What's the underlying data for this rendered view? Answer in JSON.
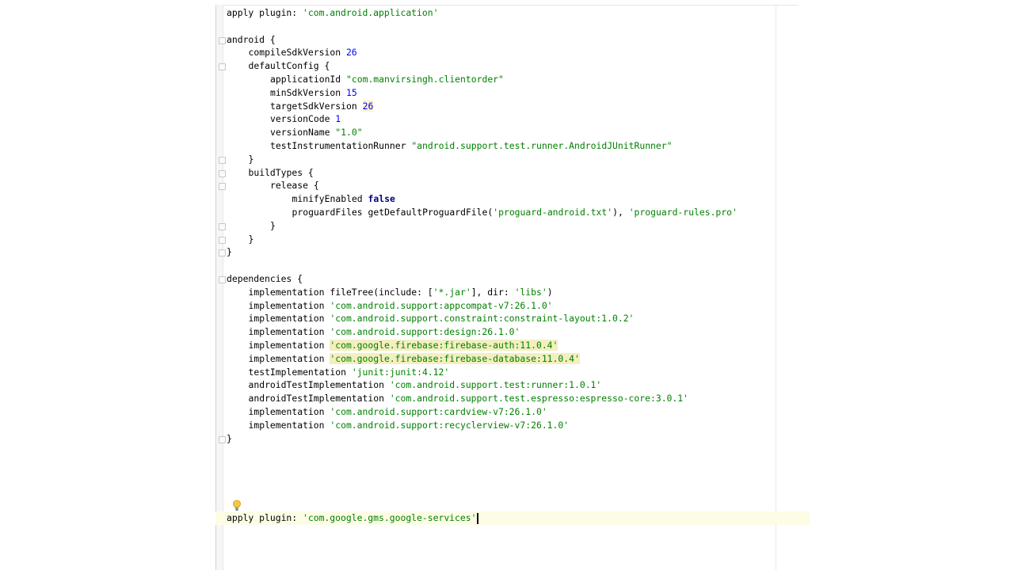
{
  "editor": {
    "lines": [
      {
        "indent": 0,
        "tokens": [
          {
            "t": "apply plugin: ",
            "c": ""
          },
          {
            "t": "'com.android.application'",
            "c": "str"
          }
        ]
      },
      {
        "indent": 0,
        "tokens": []
      },
      {
        "indent": 0,
        "tokens": [
          {
            "t": "android {",
            "c": ""
          }
        ]
      },
      {
        "indent": 1,
        "tokens": [
          {
            "t": "compileSdkVersion ",
            "c": ""
          },
          {
            "t": "26",
            "c": "num"
          }
        ]
      },
      {
        "indent": 1,
        "tokens": [
          {
            "t": "defaultConfig {",
            "c": ""
          }
        ]
      },
      {
        "indent": 2,
        "tokens": [
          {
            "t": "applicationId ",
            "c": ""
          },
          {
            "t": "\"com.manvirsingh.clientorder\"",
            "c": "str"
          }
        ]
      },
      {
        "indent": 2,
        "tokens": [
          {
            "t": "minSdkVersion ",
            "c": ""
          },
          {
            "t": "15",
            "c": "num"
          }
        ]
      },
      {
        "indent": 2,
        "tokens": [
          {
            "t": "targetSdkVersion ",
            "c": ""
          },
          {
            "t": "26",
            "c": "num warn"
          }
        ]
      },
      {
        "indent": 2,
        "tokens": [
          {
            "t": "versionCode ",
            "c": ""
          },
          {
            "t": "1",
            "c": "num"
          }
        ]
      },
      {
        "indent": 2,
        "tokens": [
          {
            "t": "versionName ",
            "c": ""
          },
          {
            "t": "\"1.0\"",
            "c": "str"
          }
        ]
      },
      {
        "indent": 2,
        "tokens": [
          {
            "t": "testInstrumentationRunner ",
            "c": ""
          },
          {
            "t": "\"android.support.test.runner.AndroidJUnitRunner\"",
            "c": "str"
          }
        ]
      },
      {
        "indent": 1,
        "tokens": [
          {
            "t": "}",
            "c": ""
          }
        ]
      },
      {
        "indent": 1,
        "tokens": [
          {
            "t": "buildTypes {",
            "c": ""
          }
        ]
      },
      {
        "indent": 2,
        "tokens": [
          {
            "t": "release {",
            "c": ""
          }
        ]
      },
      {
        "indent": 3,
        "tokens": [
          {
            "t": "minifyEnabled ",
            "c": ""
          },
          {
            "t": "false",
            "c": "kw"
          }
        ]
      },
      {
        "indent": 3,
        "tokens": [
          {
            "t": "proguardFiles getDefaultProguardFile(",
            "c": ""
          },
          {
            "t": "'proguard-android.txt'",
            "c": "str"
          },
          {
            "t": "), ",
            "c": ""
          },
          {
            "t": "'proguard-rules.pro'",
            "c": "str"
          }
        ]
      },
      {
        "indent": 2,
        "tokens": [
          {
            "t": "}",
            "c": ""
          }
        ]
      },
      {
        "indent": 1,
        "tokens": [
          {
            "t": "}",
            "c": ""
          }
        ]
      },
      {
        "indent": 0,
        "tokens": [
          {
            "t": "}",
            "c": ""
          }
        ]
      },
      {
        "indent": 0,
        "tokens": []
      },
      {
        "indent": 0,
        "tokens": [
          {
            "t": "dependencies {",
            "c": ""
          }
        ]
      },
      {
        "indent": 1,
        "tokens": [
          {
            "t": "implementation fileTree(include: [",
            "c": ""
          },
          {
            "t": "'*.jar'",
            "c": "str"
          },
          {
            "t": "], dir: ",
            "c": ""
          },
          {
            "t": "'libs'",
            "c": "str"
          },
          {
            "t": ")",
            "c": ""
          }
        ]
      },
      {
        "indent": 1,
        "tokens": [
          {
            "t": "implementation ",
            "c": ""
          },
          {
            "t": "'com.android.support:appcompat-v7:26.1.0'",
            "c": "str"
          }
        ]
      },
      {
        "indent": 1,
        "tokens": [
          {
            "t": "implementation ",
            "c": ""
          },
          {
            "t": "'com.android.support.constraint:constraint-layout:1.0.2'",
            "c": "str"
          }
        ]
      },
      {
        "indent": 1,
        "tokens": [
          {
            "t": "implementation ",
            "c": ""
          },
          {
            "t": "'com.android.support:design:26.1.0'",
            "c": "str"
          }
        ]
      },
      {
        "indent": 1,
        "tokens": [
          {
            "t": "implementation ",
            "c": ""
          },
          {
            "t": "'com.google.firebase:firebase-auth:11.0.4'",
            "c": "str hl"
          }
        ]
      },
      {
        "indent": 1,
        "tokens": [
          {
            "t": "implementation ",
            "c": ""
          },
          {
            "t": "'com.google.firebase:firebase-database:11.0.4'",
            "c": "str hl"
          }
        ]
      },
      {
        "indent": 1,
        "tokens": [
          {
            "t": "testImplementation ",
            "c": ""
          },
          {
            "t": "'junit:junit:4.12'",
            "c": "str"
          }
        ]
      },
      {
        "indent": 1,
        "tokens": [
          {
            "t": "androidTestImplementation ",
            "c": ""
          },
          {
            "t": "'com.android.support.test:runner:1.0.1'",
            "c": "str"
          }
        ]
      },
      {
        "indent": 1,
        "tokens": [
          {
            "t": "androidTestImplementation ",
            "c": ""
          },
          {
            "t": "'com.android.support.test.espresso:espresso-core:3.0.1'",
            "c": "str"
          }
        ]
      },
      {
        "indent": 1,
        "tokens": [
          {
            "t": "implementation ",
            "c": ""
          },
          {
            "t": "'com.android.support:cardview-v7:26.1.0'",
            "c": "str"
          }
        ]
      },
      {
        "indent": 1,
        "tokens": [
          {
            "t": "implementation ",
            "c": ""
          },
          {
            "t": "'com.android.support:recyclerview-v7:26.1.0'",
            "c": "str"
          }
        ]
      },
      {
        "indent": 0,
        "tokens": [
          {
            "t": "}",
            "c": ""
          }
        ]
      },
      {
        "indent": 0,
        "tokens": []
      },
      {
        "indent": 0,
        "tokens": []
      },
      {
        "indent": 0,
        "tokens": []
      },
      {
        "indent": 0,
        "tokens": []
      },
      {
        "indent": 0,
        "tokens": []
      },
      {
        "indent": 0,
        "tokens": [
          {
            "t": "apply plugin: ",
            "c": ""
          },
          {
            "t": "'com.google.gms.google-services'",
            "c": "str"
          }
        ],
        "caret": true
      }
    ],
    "intention_icon": "lightbulb-icon",
    "colors": {
      "string": "#008000",
      "number": "#0000ff",
      "keyword": "#000080",
      "usage_highlight": "#f3efbf",
      "caret_row": "#fdfde6"
    }
  }
}
